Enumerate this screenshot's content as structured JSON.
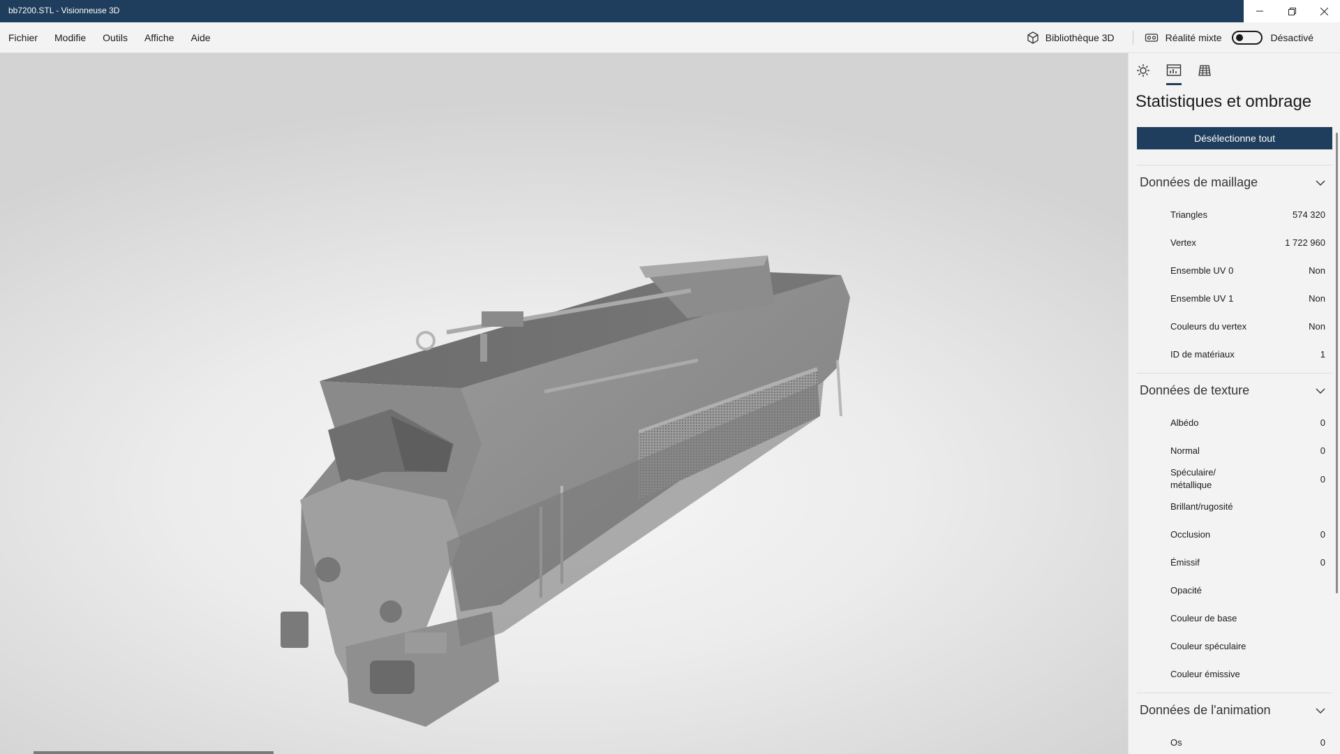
{
  "window": {
    "title": "bb7200.STL - Visionneuse 3D"
  },
  "menu": {
    "items": [
      "Fichier",
      "Modifie",
      "Outils",
      "Affiche",
      "Aide"
    ]
  },
  "toolbar": {
    "library_label": "Bibliothèque 3D",
    "mixed_reality_label": "Réalité mixte",
    "mixed_reality_state": "Désactivé"
  },
  "icons": {
    "minimize": "minimize-icon",
    "restore": "restore-icon",
    "close": "close-icon",
    "library": "cube-icon",
    "mixed_reality": "headset-icon",
    "tab_lighting": "sun-icon",
    "tab_stats": "stats-icon",
    "tab_grid": "grid-icon",
    "chevron": "chevron-down-icon"
  },
  "panel": {
    "title": "Statistiques et ombrage",
    "deselect_label": "Désélectionne tout",
    "mesh": {
      "header": "Données de maillage",
      "rows": [
        {
          "name": "Triangles",
          "value": "574 320"
        },
        {
          "name": "Vertex",
          "value": "1 722 960"
        },
        {
          "name": "Ensemble UV 0",
          "value": "Non"
        },
        {
          "name": "Ensemble UV 1",
          "value": "Non"
        },
        {
          "name": "Couleurs du vertex",
          "value": "Non"
        },
        {
          "name": "ID de matériaux",
          "value": "1"
        }
      ]
    },
    "texture": {
      "header": "Données de texture",
      "rows": [
        {
          "name": "Albédo",
          "value": "0"
        },
        {
          "name": "Normal",
          "value": "0"
        },
        {
          "name": "Spéculaire/",
          "name2": "métallique",
          "value": "0"
        },
        {
          "name": "Brillant/rugosité",
          "value": ""
        },
        {
          "name": "Occlusion",
          "value": "0"
        },
        {
          "name": "Émissif",
          "value": "0"
        },
        {
          "name": "Opacité",
          "value": ""
        },
        {
          "name": "Couleur de base",
          "value": ""
        },
        {
          "name": "Couleur spéculaire",
          "value": ""
        },
        {
          "name": "Couleur émissive",
          "value": ""
        }
      ]
    },
    "animation": {
      "header": "Données de l'animation",
      "rows": [
        {
          "name": "Os",
          "value": "0"
        }
      ]
    }
  },
  "colors": {
    "accent": "#1f3d5c",
    "panel_bg": "#f3f3f3"
  }
}
